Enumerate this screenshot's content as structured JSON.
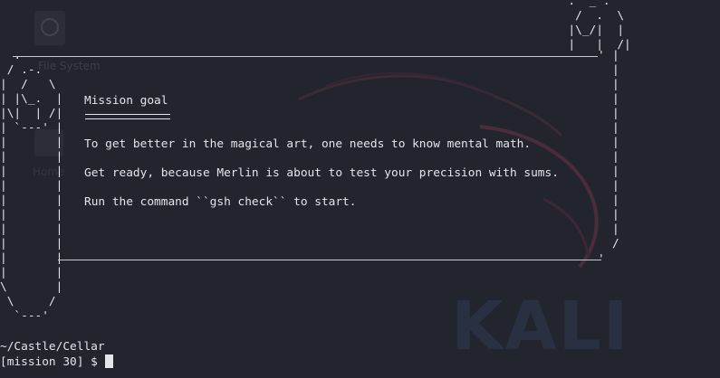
{
  "desktop": {
    "home_icon_label": "File System",
    "folder_icon_label": "Home",
    "wallpaper_logo": "KALI"
  },
  "terminal": {
    "mission_title": "Mission goal",
    "lines": [
      "To get better in the magical art, one needs to know mental math.",
      "Get ready, because Merlin is about to test your precision with sums.",
      "Run the command ``gsh check`` to start."
    ],
    "current_path": "~/Castle/Cellar",
    "prompt": "[mission 30] $ ",
    "input_value": ""
  },
  "colors": {
    "background": "#23252e",
    "text": "#e3e5ea",
    "scroll_border": "#c7c9cf"
  }
}
